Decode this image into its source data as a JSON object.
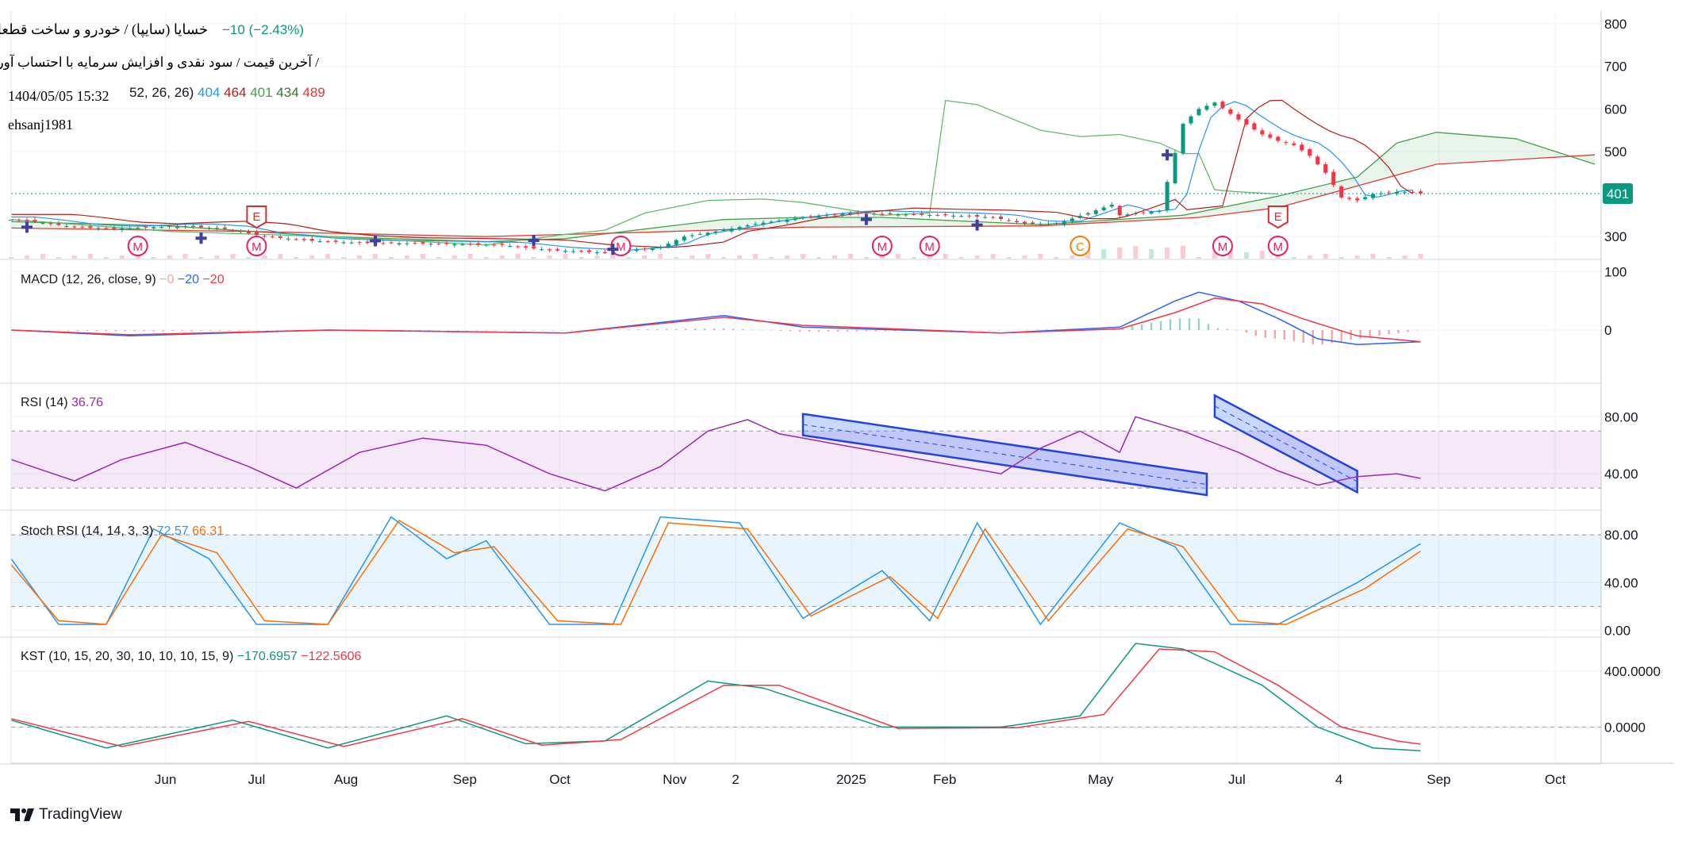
{
  "header": {
    "title_line": "خسایا (سایپا) / خودرو و ساخت قطعات",
    "change_value": "−10",
    "change_pct": "(−2.43%)",
    "subtitle_line": "آخرین قیمت / سود نقدی و افزایش سرمایه با احتساب آورده /",
    "datetime": "1404/05/05 15:32",
    "author": "ehsanj1981",
    "ichimoku_params": "52, 26, 26)",
    "ichimoku_values": [
      {
        "text": "404",
        "color": "#2196f3"
      },
      {
        "text": "464",
        "color": "#b71c1c"
      },
      {
        "text": "401",
        "color": "#43a047"
      },
      {
        "text": "434",
        "color": "#2e7d32"
      },
      {
        "text": "489",
        "color": "#e53935"
      }
    ]
  },
  "colors": {
    "up": "#089981",
    "down": "#f23645",
    "macd": "#2962ff",
    "signal": "#f23645",
    "rsi": "#9c27b0",
    "stoch_k": "#2196f3",
    "stoch_d": "#ff6d00",
    "kst": "#089981",
    "kst_signal": "#f23645",
    "price_badge": "#089981",
    "marker_m": "#e91e63",
    "marker_e": "#d32f2f",
    "marker_c": "#f57c00",
    "channel": "#2244dd"
  },
  "chart_data": [
    {
      "type": "candlestick",
      "title": "خسایا (سایپا) / خودرو و ساخت قطعات",
      "x_tick_labels": [
        "Jun",
        "Jul",
        "Aug",
        "Sep",
        "Oct",
        "Nov",
        "2",
        "2025",
        "Feb",
        "May",
        "Jul",
        "4",
        "Sep",
        "Oct"
      ],
      "y_tick_labels": [
        "800",
        "700",
        "600",
        "500",
        "300"
      ],
      "ylim": [
        248,
        830
      ],
      "last_price": "401",
      "price_path": [
        [
          0,
          340
        ],
        [
          4,
          332
        ],
        [
          8,
          322
        ],
        [
          13,
          318
        ],
        [
          18,
          322
        ],
        [
          22,
          324
        ],
        [
          27,
          318
        ],
        [
          32,
          300
        ],
        [
          38,
          290
        ],
        [
          44,
          285
        ],
        [
          50,
          284
        ],
        [
          56,
          282
        ],
        [
          62,
          280
        ],
        [
          68,
          268
        ],
        [
          75,
          262
        ],
        [
          78,
          266
        ],
        [
          82,
          275
        ],
        [
          85,
          300
        ],
        [
          90,
          315
        ],
        [
          94,
          330
        ],
        [
          100,
          345
        ],
        [
          106,
          355
        ],
        [
          112,
          352
        ],
        [
          118,
          350
        ],
        [
          124,
          345
        ],
        [
          128,
          330
        ],
        [
          132,
          330
        ],
        [
          136,
          355
        ],
        [
          139,
          375
        ],
        [
          140,
          350
        ],
        [
          145,
          360
        ],
        [
          148,
          565
        ],
        [
          150,
          600
        ],
        [
          152,
          615
        ],
        [
          155,
          575
        ],
        [
          158,
          540
        ],
        [
          160,
          525
        ],
        [
          162,
          515
        ],
        [
          164,
          490
        ],
        [
          166,
          450
        ],
        [
          168,
          392
        ],
        [
          170,
          385
        ],
        [
          172,
          400
        ],
        [
          175,
          405
        ],
        [
          177,
          403
        ],
        [
          178,
          401
        ]
      ],
      "cloud_a": [
        [
          0,
          335
        ],
        [
          20,
          325
        ],
        [
          40,
          300
        ],
        [
          60,
          288
        ],
        [
          70,
          295
        ],
        [
          90,
          340
        ],
        [
          100,
          345
        ],
        [
          110,
          345
        ],
        [
          130,
          328
        ],
        [
          148,
          350
        ],
        [
          160,
          395
        ],
        [
          170,
          440
        ],
        [
          175,
          520
        ],
        [
          180,
          545
        ],
        [
          190,
          530
        ],
        [
          200,
          470
        ]
      ],
      "cloud_b": [
        [
          0,
          320
        ],
        [
          30,
          312
        ],
        [
          60,
          300
        ],
        [
          80,
          310
        ],
        [
          100,
          322
        ],
        [
          130,
          325
        ],
        [
          150,
          345
        ],
        [
          160,
          368
        ],
        [
          180,
          470
        ],
        [
          200,
          492
        ]
      ],
      "chikou": [
        [
          0,
          340
        ],
        [
          20,
          312
        ],
        [
          40,
          300
        ],
        [
          60,
          280
        ],
        [
          70,
          305
        ],
        [
          75,
          315
        ],
        [
          80,
          355
        ],
        [
          88,
          385
        ],
        [
          95,
          388
        ],
        [
          100,
          380
        ],
        [
          110,
          350
        ],
        [
          116,
          355
        ],
        [
          118,
          620
        ],
        [
          122,
          610
        ],
        [
          130,
          550
        ],
        [
          135,
          535
        ],
        [
          140,
          540
        ],
        [
          145,
          520
        ],
        [
          148,
          495
        ],
        [
          150,
          495
        ],
        [
          152,
          410
        ],
        [
          155,
          405
        ],
        [
          160,
          400
        ]
      ],
      "markers": [
        {
          "label": "M",
          "x": 16
        },
        {
          "label": "M",
          "x": 31
        },
        {
          "label": "E",
          "x": 31
        },
        {
          "label": "M",
          "x": 77
        },
        {
          "label": "M",
          "x": 110
        },
        {
          "label": "M",
          "x": 116
        },
        {
          "label": "C",
          "x": 135
        },
        {
          "label": "M",
          "x": 153
        },
        {
          "label": "M",
          "x": 160
        },
        {
          "label": "E",
          "x": 160
        }
      ]
    },
    {
      "type": "line",
      "title": "MACD (12, 26, close, 9)",
      "legend_values": [
        {
          "text": "−0",
          "color": "#f7a5a5"
        },
        {
          "text": "−20",
          "color": "#2962ff"
        },
        {
          "text": "−20",
          "color": "#f23645"
        }
      ],
      "y_tick_labels": [
        "100",
        "0"
      ],
      "ylim": [
        -90,
        120
      ],
      "series": [
        {
          "values": [
            [
              0,
              0
            ],
            [
              15,
              -10
            ],
            [
              40,
              0
            ],
            [
              70,
              -5
            ],
            [
              90,
              25
            ],
            [
              100,
              5
            ],
            [
              125,
              -5
            ],
            [
              140,
              5
            ],
            [
              147,
              50
            ],
            [
              150,
              65
            ],
            [
              155,
              50
            ],
            [
              160,
              20
            ],
            [
              165,
              -15
            ],
            [
              170,
              -25
            ],
            [
              178,
              -20
            ]
          ]
        },
        {
          "values": [
            [
              0,
              0
            ],
            [
              15,
              -8
            ],
            [
              40,
              0
            ],
            [
              70,
              -5
            ],
            [
              90,
              22
            ],
            [
              100,
              8
            ],
            [
              125,
              -5
            ],
            [
              140,
              2
            ],
            [
              147,
              30
            ],
            [
              152,
              55
            ],
            [
              158,
              45
            ],
            [
              163,
              20
            ],
            [
              170,
              -10
            ],
            [
              178,
              -20
            ]
          ]
        }
      ]
    },
    {
      "type": "line",
      "title": "RSI (14)",
      "legend_values": [
        {
          "text": "36.76",
          "color": "#9c27b0"
        }
      ],
      "y_tick_labels": [
        "80.00",
        "40.00"
      ],
      "ylim": [
        15,
        103
      ],
      "series": [
        {
          "values": [
            [
              0,
              50
            ],
            [
              8,
              35
            ],
            [
              14,
              50
            ],
            [
              22,
              62
            ],
            [
              30,
              45
            ],
            [
              36,
              30
            ],
            [
              44,
              55
            ],
            [
              52,
              65
            ],
            [
              60,
              60
            ],
            [
              68,
              40
            ],
            [
              75,
              28
            ],
            [
              82,
              45
            ],
            [
              88,
              70
            ],
            [
              93,
              78
            ],
            [
              97,
              68
            ],
            [
              105,
              60
            ],
            [
              115,
              50
            ],
            [
              125,
              40
            ],
            [
              130,
              58
            ],
            [
              135,
              70
            ],
            [
              140,
              55
            ],
            [
              142,
              80
            ],
            [
              148,
              70
            ],
            [
              155,
              55
            ],
            [
              160,
              42
            ],
            [
              165,
              32
            ],
            [
              170,
              38
            ],
            [
              175,
              40
            ],
            [
              178,
              36.76
            ]
          ]
        }
      ]
    },
    {
      "type": "line",
      "title": "Stoch RSI (14, 14, 3, 3)",
      "legend_values": [
        {
          "text": "72.57",
          "color": "#2196f3"
        },
        {
          "text": "66.31",
          "color": "#ff6d00"
        }
      ],
      "y_tick_labels": [
        "80.00",
        "40.00",
        "0.00"
      ],
      "ylim": [
        -5,
        100
      ],
      "series": [
        {
          "values": [
            [
              0,
              60
            ],
            [
              6,
              5
            ],
            [
              12,
              5
            ],
            [
              18,
              85
            ],
            [
              25,
              60
            ],
            [
              31,
              5
            ],
            [
              40,
              5
            ],
            [
              48,
              95
            ],
            [
              55,
              60
            ],
            [
              60,
              75
            ],
            [
              68,
              5
            ],
            [
              76,
              5
            ],
            [
              82,
              95
            ],
            [
              92,
              90
            ],
            [
              100,
              10
            ],
            [
              110,
              50
            ],
            [
              116,
              8
            ],
            [
              122,
              90
            ],
            [
              130,
              5
            ],
            [
              140,
              90
            ],
            [
              147,
              70
            ],
            [
              154,
              5
            ],
            [
              160,
              5
            ],
            [
              170,
              40
            ],
            [
              178,
              72.57
            ]
          ]
        },
        {
          "values": [
            [
              0,
              55
            ],
            [
              6,
              8
            ],
            [
              12,
              5
            ],
            [
              19,
              80
            ],
            [
              26,
              65
            ],
            [
              32,
              8
            ],
            [
              40,
              5
            ],
            [
              49,
              92
            ],
            [
              56,
              65
            ],
            [
              61,
              70
            ],
            [
              69,
              8
            ],
            [
              77,
              5
            ],
            [
              83,
              90
            ],
            [
              93,
              85
            ],
            [
              101,
              12
            ],
            [
              111,
              45
            ],
            [
              117,
              10
            ],
            [
              123,
              85
            ],
            [
              131,
              8
            ],
            [
              141,
              85
            ],
            [
              148,
              70
            ],
            [
              155,
              8
            ],
            [
              161,
              5
            ],
            [
              171,
              35
            ],
            [
              178,
              66.31
            ]
          ]
        }
      ]
    },
    {
      "type": "line",
      "title": "KST (10, 15, 20, 30, 10, 10, 10, 15, 9)",
      "legend_values": [
        {
          "text": "−170.6957",
          "color": "#089981"
        },
        {
          "text": "−122.5606",
          "color": "#f23645"
        }
      ],
      "y_tick_labels": [
        "400.0000",
        "0.0000"
      ],
      "ylim": [
        -260,
        640
      ],
      "series": [
        {
          "values": [
            [
              0,
              50
            ],
            [
              12,
              -150
            ],
            [
              28,
              50
            ],
            [
              40,
              -150
            ],
            [
              55,
              80
            ],
            [
              65,
              -120
            ],
            [
              75,
              -100
            ],
            [
              88,
              330
            ],
            [
              95,
              280
            ],
            [
              110,
              0
            ],
            [
              125,
              0
            ],
            [
              135,
              80
            ],
            [
              142,
              600
            ],
            [
              148,
              560
            ],
            [
              158,
              300
            ],
            [
              165,
              0
            ],
            [
              172,
              -150
            ],
            [
              178,
              -170.6957
            ]
          ]
        },
        {
          "values": [
            [
              0,
              60
            ],
            [
              14,
              -140
            ],
            [
              30,
              40
            ],
            [
              42,
              -140
            ],
            [
              57,
              60
            ],
            [
              67,
              -130
            ],
            [
              77,
              -90
            ],
            [
              90,
              300
            ],
            [
              97,
              300
            ],
            [
              112,
              -10
            ],
            [
              127,
              -5
            ],
            [
              138,
              90
            ],
            [
              145,
              560
            ],
            [
              152,
              540
            ],
            [
              160,
              300
            ],
            [
              168,
              0
            ],
            [
              175,
              -100
            ],
            [
              178,
              -122.5606
            ]
          ]
        }
      ]
    }
  ]
}
